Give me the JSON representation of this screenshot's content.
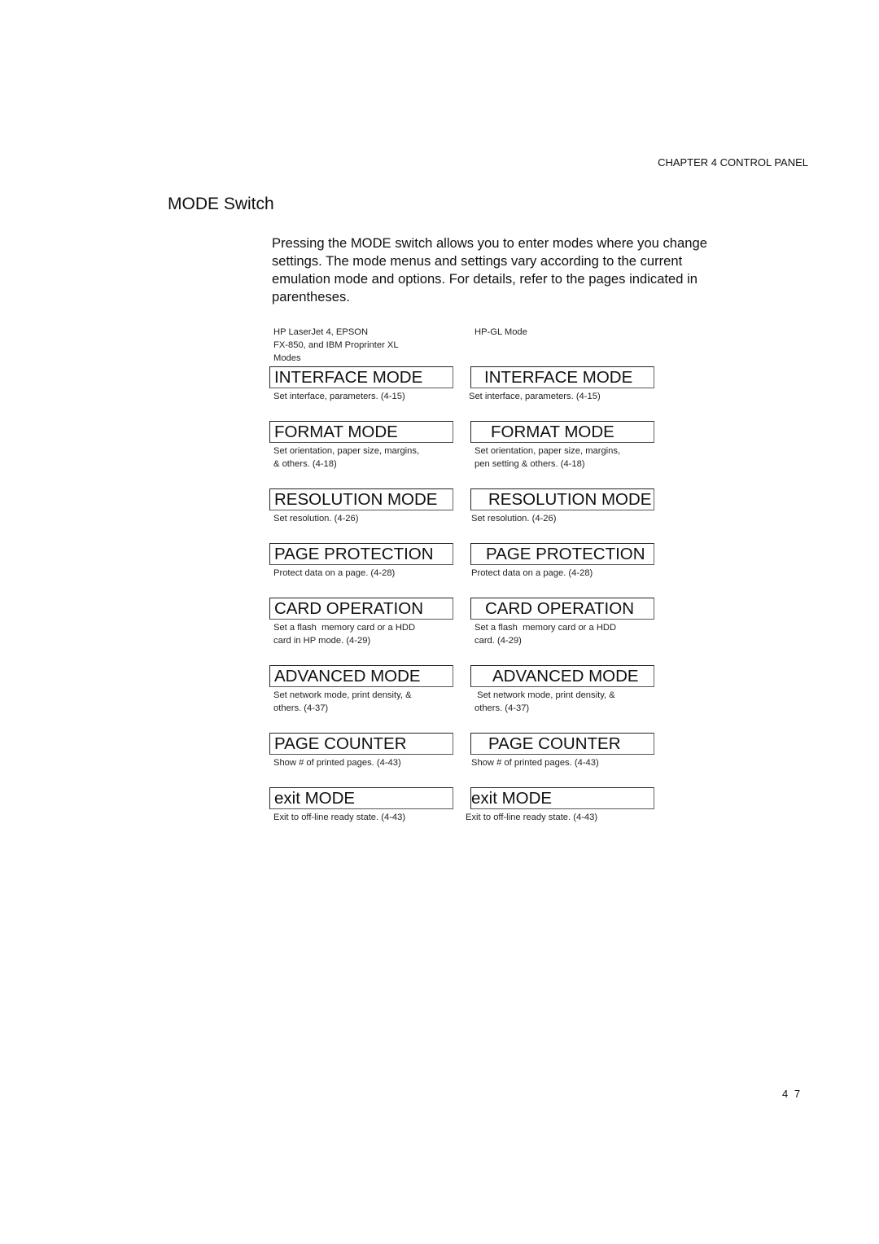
{
  "header": {
    "chapter": "CHAPTER 4 CONTROL PANEL"
  },
  "section": {
    "title": "MODE Switch",
    "intro": "Pressing the MODE switch allows you to enter modes where you change settings. The mode menus and settings vary according to the current emulation mode and options. For details, refer to the pages indicated in parentheses."
  },
  "columns": {
    "left_caption_lines": [
      "HP LaserJet 4, EPSON",
      "FX-850, and IBM Proprinter XL",
      "Modes"
    ],
    "right_caption": "HP-GL Mode"
  },
  "modes": [
    {
      "left": {
        "label": "INTERFACE MODE",
        "desc": [
          "Set interface, parameters. (4-15)"
        ]
      },
      "right": {
        "label": "INTERFACE MODE",
        "desc": [
          "Set interface, parameters. (4-15)"
        ]
      }
    },
    {
      "left": {
        "label": "FORMAT MODE",
        "desc": [
          "Set orientation, paper size, margins,",
          "& others. (4-18)"
        ]
      },
      "right": {
        "label": "FORMAT MODE",
        "desc": [
          "Set orientation, paper size, margins,",
          "pen setting & others. (4-18)"
        ]
      }
    },
    {
      "left": {
        "label": "RESOLUTION MODE",
        "desc": [
          "Set resolution. (4-26)"
        ]
      },
      "right": {
        "label": "RESOLUTION MODE",
        "desc": [
          "Set resolution. (4-26)"
        ]
      }
    },
    {
      "left": {
        "label": "PAGE PROTECTION",
        "desc": [
          "Protect data on a page. (4-28)"
        ]
      },
      "right": {
        "label": "PAGE PROTECTION",
        "desc": [
          "Protect data on a page. (4-28)"
        ]
      }
    },
    {
      "left": {
        "label": "CARD OPERATION",
        "desc": [
          "Set a flash  memory card or a HDD",
          "card in HP mode. (4-29)"
        ]
      },
      "right": {
        "label": "CARD OPERATION",
        "desc": [
          "Set a flash  memory card or a HDD",
          "card. (4-29)"
        ]
      }
    },
    {
      "left": {
        "label": "ADVANCED MODE",
        "desc": [
          "Set network mode, print density, &",
          "others. (4-37)"
        ]
      },
      "right": {
        "label": "ADVANCED MODE",
        "desc": [
          " Set network mode, print density, &",
          "others. (4-37)"
        ]
      }
    },
    {
      "left": {
        "label": "PAGE COUNTER",
        "desc": [
          "Show # of printed pages. (4-43)"
        ]
      },
      "right": {
        "label": "PAGE COUNTER",
        "desc": [
          "Show # of printed pages. (4-43)"
        ]
      }
    },
    {
      "left": {
        "label": "exit MODE",
        "desc": [
          "Exit to off-line ready state. (4-43)"
        ]
      },
      "right": {
        "label": "exit MODE",
        "desc": [
          "Exit to off-line ready state. (4-43)"
        ]
      }
    }
  ],
  "footer": {
    "page_number": "4 7"
  }
}
